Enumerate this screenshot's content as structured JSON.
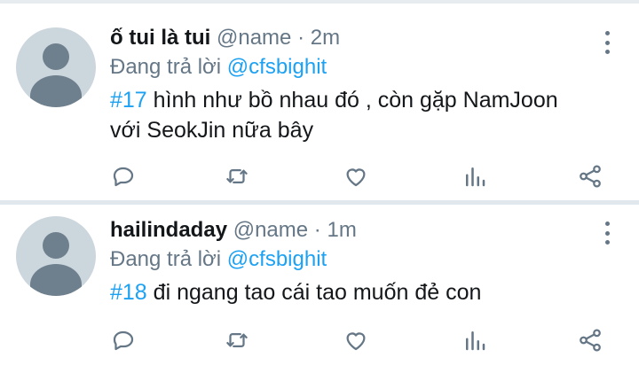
{
  "tweets": [
    {
      "name": "ố tui là tui",
      "handle": "@name",
      "separator": "·",
      "time": "2m",
      "reply_prefix": "Đang trả lời",
      "reply_to": "@cfsbighit",
      "hashtag": "#17",
      "text": "hình như bồ nhau đó , còn gặp NamJoon với SeokJin nữa bây"
    },
    {
      "name": "hailindaday",
      "handle": "@name",
      "separator": "·",
      "time": "1m",
      "reply_prefix": "Đang trả lời",
      "reply_to": "@cfsbighit",
      "hashtag": "#18",
      "text": "đi ngang tao cái tao muốn đẻ con"
    }
  ],
  "colors": {
    "accent": "#1da1f2",
    "secondary_text": "#657786",
    "primary_text": "#14171a",
    "divider": "#e1e8ed",
    "avatar_bg": "#ccd6dd",
    "avatar_fg": "#6e7f8d"
  },
  "icons": [
    "more-vertical-icon",
    "reply-icon",
    "retweet-icon",
    "like-icon",
    "analytics-icon",
    "share-icon"
  ]
}
